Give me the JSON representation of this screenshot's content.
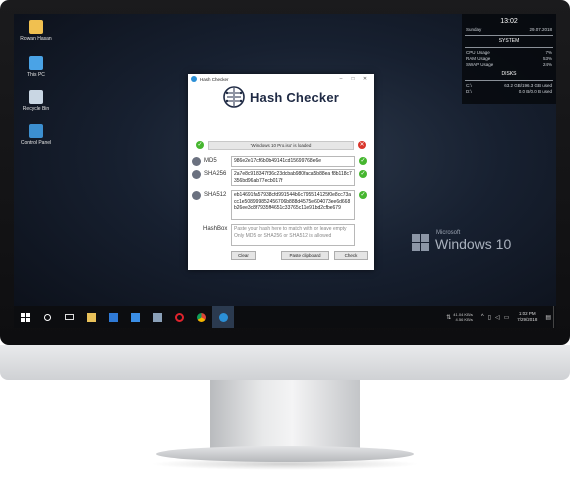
{
  "desktop": {
    "icons": [
      {
        "label": "Rowan Hasan",
        "color": "#f0c050"
      },
      {
        "label": "This PC",
        "color": "#4aa3e6"
      },
      {
        "label": "Recycle Bin",
        "color": "#c9d6e3"
      },
      {
        "label": "Control Panel",
        "color": "#3c8fd0"
      }
    ]
  },
  "gadget": {
    "time": "13:02",
    "day": "Sunday",
    "date": "29.07.2018",
    "system_heading": "SYSTEM",
    "cpu_label": "CPU Usage",
    "cpu_value": "7%",
    "ram_label": "RAM Usage",
    "ram_value": "53%",
    "swap_label": "SWAP Usage",
    "swap_value": "24%",
    "disks_heading": "DISKS",
    "disk_c_label": "C:\\",
    "disk_c_value": "63.2 GB/196.3 GB used",
    "disk_d_label": "D:\\",
    "disk_d_value": "0.0 B/0.0 B used"
  },
  "branding": {
    "small": "Microsoft",
    "large": "Windows 10"
  },
  "app": {
    "window_title": "Hash Checker",
    "logo_text": "Hash Checker",
    "status_text": "'Windows 10 Pro.iso' is loaded",
    "md5_label": "MD5",
    "md5_value": "986e2e17cf6b0b49141cd15699768e6e",
    "sha256_label": "SHA256",
    "sha256_value": "2a7e8c918347f36c23dcbab980faca5b88ea f8b118c7356bd96ab77ecb017f",
    "sha512_label": "SHA512",
    "sha512_value": "eb14691fa57938cfd991544b6c795514125f0e8cc73acc1e508999852456706b888d4575e604073ee6d668b26ee3c8f7935ff4651c33765c11e91bd2cfbe679",
    "hashbox_label": "HashBox",
    "hashbox_placeholder": "Paste your hash here to match with or leave empty\nOnly MD5 or SHA256 or SHA512 is allowed",
    "btn_clear": "Clear",
    "btn_paste": "Paste clipboard",
    "btn_check": "Check"
  },
  "taskbar": {
    "net_up": "41.04 KB/s",
    "net_down": "4.56 KB/s",
    "clock_time": "1:02 PM",
    "clock_date": "7/29/2018",
    "apps": [
      "start",
      "search",
      "task-view",
      "file-explorer",
      "mail",
      "store",
      "calendar",
      "opera",
      "chrome",
      "hash-checker"
    ]
  },
  "colors": {
    "ok": "#46b62f",
    "error": "#d9352b",
    "accent": "#2b8fd6"
  }
}
